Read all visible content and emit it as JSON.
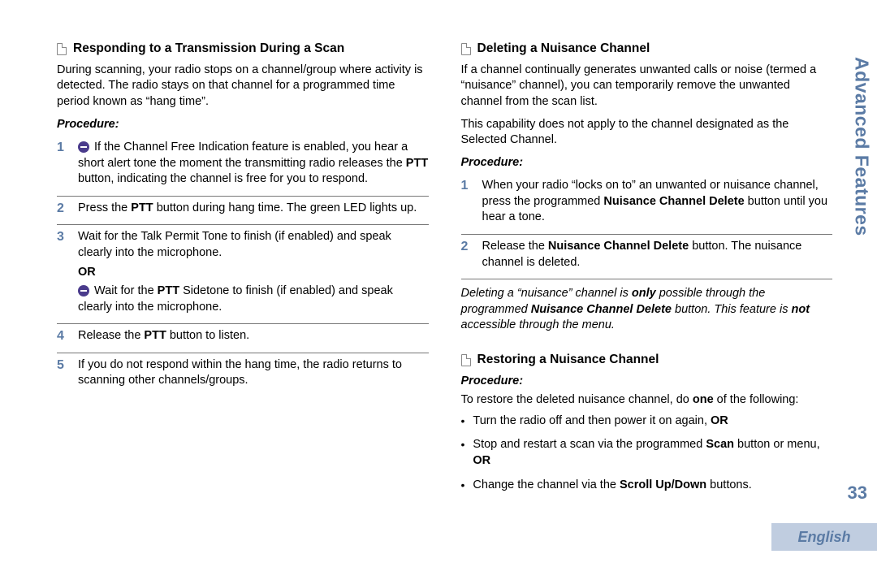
{
  "side_tab": "Advanced Features",
  "page_number": "33",
  "language": "English",
  "left": {
    "heading": "Responding to a Transmission During a Scan",
    "intro": "During scanning, your radio stops on a channel/group where activity is detected. The radio stays on that channel for a programmed time period known as “hang time”.",
    "procedure_label": "Procedure:",
    "steps": {
      "s1_a": "If the Channel Free Indication feature is enabled, you hear a short alert tone the moment the transmitting radio releases the ",
      "s1_b": " button, indicating the channel is free for you to respond.",
      "s2_a": "Press the ",
      "s2_b": " button during hang time. The green LED lights up.",
      "s3_a": "Wait for the Talk Permit Tone to finish (if enabled) and speak clearly into the microphone.",
      "s3_or": "OR",
      "s3_b": "Wait for the ",
      "s3_c": " Sidetone to finish (if enabled) and speak clearly into the microphone.",
      "s4_a": "Release the ",
      "s4_b": " button to listen.",
      "s5": "If you do not respond within the hang time, the radio returns to scanning other channels/groups."
    },
    "ptt": "PTT"
  },
  "right": {
    "del_heading": "Deleting a Nuisance Channel",
    "del_p1": "If a channel continually generates unwanted calls or noise (termed a “nuisance” channel), you can temporarily remove the unwanted channel from the scan list.",
    "del_p2": "This capability does not apply to the channel designated as the Selected Channel.",
    "procedure_label": "Procedure:",
    "del_s1_a": "When your radio “locks on to” an unwanted or nuisance channel, press the programmed ",
    "del_s1_b": " button until you hear a tone.",
    "del_s2_a": "Release the ",
    "del_s2_b": " button. The nuisance channel is deleted.",
    "ncd": "Nuisance Channel Delete",
    "note_a": "Deleting a “nuisance” channel is ",
    "note_only": "only",
    "note_b": " possible through the programmed ",
    "note_c": " button. This feature is ",
    "note_not": "not",
    "note_d": " accessible through the menu.",
    "rest_heading": "Restoring a Nuisance Channel",
    "rest_intro_a": "To restore the deleted nuisance channel, do ",
    "rest_one": "one",
    "rest_intro_b": " of the following:",
    "b1_a": "Turn the radio off and then power it on again, ",
    "b2_a": "Stop and restart a scan via the programmed ",
    "b2_scan": "Scan",
    "b2_b": " button or menu, ",
    "b3_a": "Change the channel via the ",
    "b3_scroll": "Scroll Up/Down",
    "b3_b": " buttons.",
    "or_word": "OR"
  }
}
